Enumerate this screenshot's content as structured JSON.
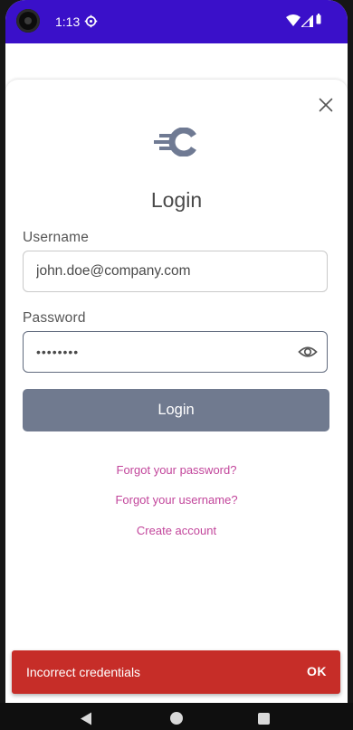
{
  "status_bar": {
    "time": "1:13",
    "icons": [
      "camera-icon",
      "settings-gear-icon",
      "wifi-icon",
      "signal-icon",
      "battery-icon"
    ]
  },
  "sheet": {
    "title": "Login",
    "close_icon": "close-icon",
    "logo_icon": "brand-c-logo-icon",
    "username": {
      "label": "Username",
      "value": "john.doe@company.com"
    },
    "password": {
      "label": "Password",
      "value": "••••••••",
      "toggle_icon": "eye-icon"
    },
    "login_button": "Login",
    "links": {
      "forgot_password": "Forgot your password?",
      "forgot_username": "Forgot your username?",
      "create_account": "Create account"
    }
  },
  "snackbar": {
    "message": "Incorrect credentials",
    "action": "OK",
    "color": "#c62d28"
  },
  "nav_bar": {
    "icons": [
      "back-icon",
      "home-icon",
      "recents-icon"
    ]
  },
  "colors": {
    "status_bar": "#3a10c9",
    "primary_button": "#707a8f",
    "link": "#c2459b",
    "logo": "#6f7a93"
  }
}
